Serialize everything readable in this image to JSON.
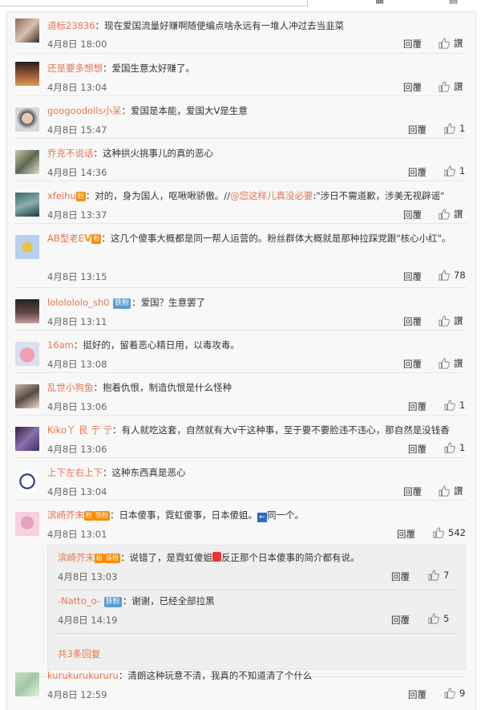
{
  "labels": {
    "reply": "回覆",
    "like": "讚"
  },
  "comments": [
    {
      "user": "道标23836",
      "sep": "：",
      "text": "现在爱国流量好赚啊随便编点啥永远有一堆人冲过去当韭菜",
      "date": "4月8日 18:00",
      "likes": "讚"
    },
    {
      "user": "还是要多想想",
      "sep": "：",
      "text": "爱国生意太好赚了。",
      "date": "4月8日 13:04",
      "likes": "讚"
    },
    {
      "user": "googoodolls小呆",
      "sep": "：",
      "text": "爱国是本能，爱国大V是生意",
      "date": "4月8日 15:47",
      "likes": "1"
    },
    {
      "user": "乔克不说话",
      "sep": "：",
      "text": "这种拱火挑事儿的真的恶心",
      "date": "4月8日 14:36",
      "likes": "1"
    },
    {
      "user": "xfeihu",
      "sep": "：",
      "text": "对的，身为国人，呕啾啾骄傲。//",
      "mention": "@您这样儿真没必要",
      "text2": ":\"涉日不需道歉，涉美无视辟谣\"",
      "date": "4月8日 13:37",
      "likes": "讚"
    },
    {
      "user": "AB型老E",
      "sep": "：",
      "text": "这几个傻事大概都是同一帮人运营的。粉丝群体大概就是那种拉踩党跟\"核心小红\"。",
      "date": "4月8日 13:15",
      "likes": "78"
    },
    {
      "user": "lololololo_sh0",
      "badge": "铁粉",
      "sep": "：",
      "text": "爱国？生意罢了",
      "date": "4月8日 13:11",
      "likes": "讚"
    },
    {
      "user": "16am",
      "sep": "：",
      "text": "挺好的，留着恶心精日用，以毒攻毒。",
      "date": "4月8日 13:08",
      "likes": "讚"
    },
    {
      "user": "乱世小狗鱼",
      "sep": "：",
      "text": "抱着仇恨，制造仇恨是什么怪种",
      "date": "4月8日 13:06",
      "likes": "1"
    },
    {
      "user": "Kiko丫 艮 亍 亍",
      "sep": "：",
      "text": "有人就吃这套，自然就有大v干这种事，至于要不要脸违不违心，那自然是没钱香",
      "date": "4月8日 13:06",
      "likes": "1"
    },
    {
      "user": "上下左右上下",
      "sep": "：",
      "text": "这种东西真是恶心",
      "date": "4月8日 13:04",
      "likes": "讚"
    },
    {
      "user": "滨崎芥末",
      "badge": "铁粉",
      "sep": "：",
      "text": "日本傻事，霓虹傻事，日本傻姐。",
      "text2": "同一个。",
      "date": "4月8日 13:01",
      "likes": "542"
    },
    {
      "user": "kurukurukururu",
      "sep": "：",
      "text": "清朗这种玩意不清，我真的不知道清了个什么",
      "date": "4月8日 12:59",
      "likes": "9"
    }
  ],
  "replies": [
    {
      "user": "滨崎芥末",
      "badge": "铁粉",
      "sep": "：",
      "text": "说错了，是霓虹傻姐",
      "text2": "反正那个日本傻事的简介都有说。",
      "date": "4月8日 13:03",
      "likes": "7"
    },
    {
      "user": "-Natto_o-",
      "badge": "铁粉",
      "sep": "：",
      "text": "谢谢，已经全部拉黑",
      "date": "4月8日 14:19",
      "likes": "5"
    }
  ],
  "more_replies": "共3条回复",
  "colors": {
    "username": "#eb7350",
    "badge_tie": "#5b9bd5"
  }
}
